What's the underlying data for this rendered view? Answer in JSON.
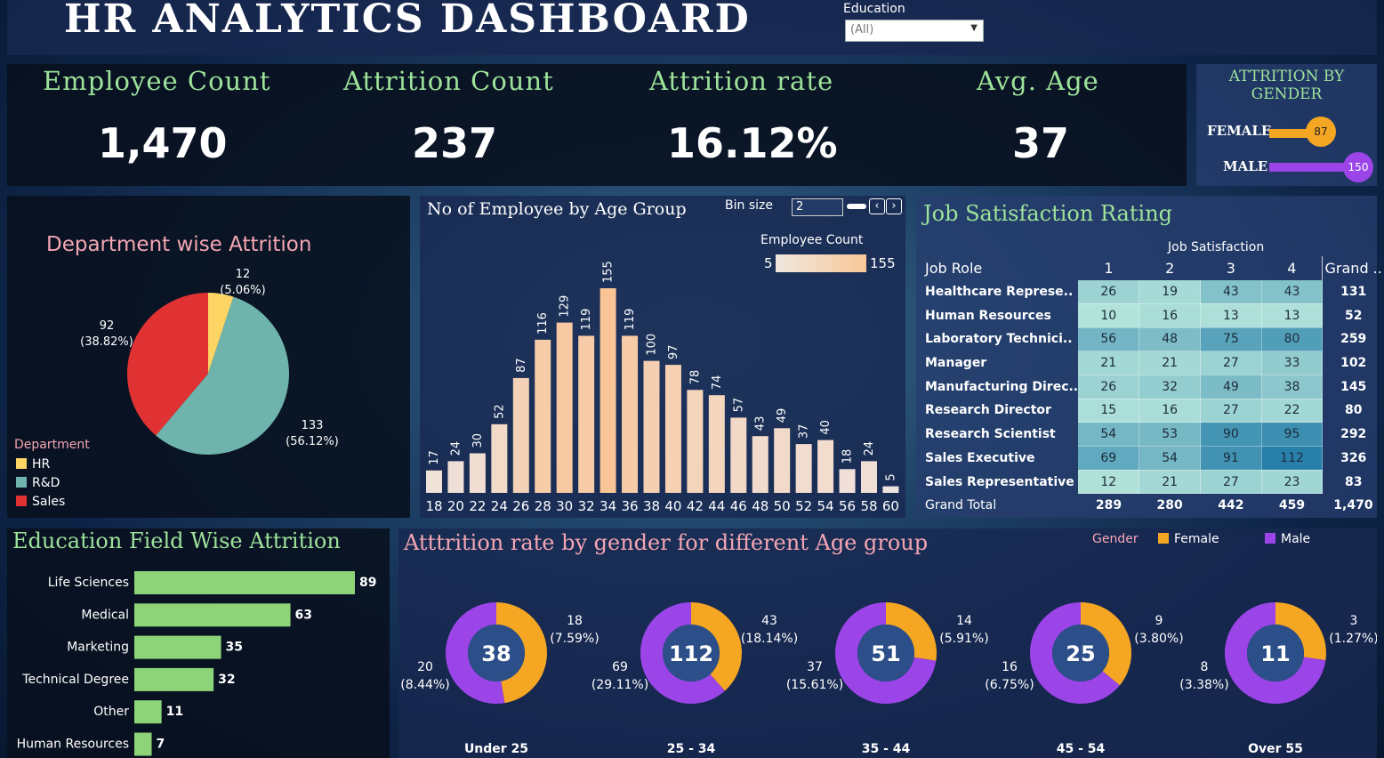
{
  "title": "HR ANALYTICS DASHBOARD",
  "filter": {
    "label": "Education",
    "value": "(All)"
  },
  "kpis": [
    {
      "title": "Employee Count",
      "value": "1,470"
    },
    {
      "title": "Attrition Count",
      "value": "237"
    },
    {
      "title": "Attrition rate",
      "value": "16.12%"
    },
    {
      "title": "Avg. Age",
      "value": "37"
    }
  ],
  "gender_attrition": {
    "title_l1": "ATTRITION BY",
    "title_l2": "GENDER",
    "items": [
      {
        "label": "FEMALE",
        "value": 87,
        "color": "#f5a623"
      },
      {
        "label": "MALE",
        "value": 150,
        "color": "#9b45e8"
      }
    ]
  },
  "dept": {
    "title": "Department wise Attrition",
    "legend_title": "Department",
    "slices": [
      {
        "name": "HR",
        "value": 12,
        "label": "12",
        "pct": "(5.06%)",
        "color": "#fcd565"
      },
      {
        "name": "R&D",
        "value": 133,
        "label": "133",
        "pct": "(56.12%)",
        "color": "#6fb3ad"
      },
      {
        "name": "Sales",
        "value": 92,
        "label": "92",
        "pct": "(38.82%)",
        "color": "#e03232"
      }
    ]
  },
  "age": {
    "title": "No of Employee by Age Group",
    "bin_label": "Bin size",
    "bin_value": "2",
    "legend_title": "Employee Count",
    "legend_min": "5",
    "legend_max": "155",
    "categories": [
      "18",
      "20",
      "22",
      "24",
      "26",
      "28",
      "30",
      "32",
      "34",
      "36",
      "38",
      "40",
      "42",
      "44",
      "46",
      "48",
      "50",
      "52",
      "54",
      "56",
      "58",
      "60"
    ],
    "values": [
      17,
      24,
      30,
      52,
      87,
      116,
      129,
      119,
      155,
      119,
      100,
      97,
      78,
      74,
      57,
      43,
      49,
      37,
      40,
      18,
      24,
      5
    ]
  },
  "job": {
    "title": "Job Satisfaction Rating",
    "col_group": "Job Satisfaction",
    "role_header": "Job Role",
    "cols": [
      "1",
      "2",
      "3",
      "4"
    ],
    "grand_header": "Grand ..",
    "rows": [
      {
        "role": "Healthcare Represe..",
        "v": [
          26,
          19,
          43,
          43
        ],
        "total": "131"
      },
      {
        "role": "Human Resources",
        "v": [
          10,
          16,
          13,
          13
        ],
        "total": "52"
      },
      {
        "role": "Laboratory Technici..",
        "v": [
          56,
          48,
          75,
          80
        ],
        "total": "259"
      },
      {
        "role": "Manager",
        "v": [
          21,
          21,
          27,
          33
        ],
        "total": "102"
      },
      {
        "role": "Manufacturing Direc..",
        "v": [
          26,
          32,
          49,
          38
        ],
        "total": "145"
      },
      {
        "role": "Research Director",
        "v": [
          15,
          16,
          27,
          22
        ],
        "total": "80"
      },
      {
        "role": "Research Scientist",
        "v": [
          54,
          53,
          90,
          95
        ],
        "total": "292"
      },
      {
        "role": "Sales Executive",
        "v": [
          69,
          54,
          91,
          112
        ],
        "total": "326"
      },
      {
        "role": "Sales Representative",
        "v": [
          12,
          21,
          27,
          23
        ],
        "total": "83"
      }
    ],
    "grand_label": "Grand Total",
    "grand": [
      "289",
      "280",
      "442",
      "459",
      "1,470"
    ]
  },
  "edu": {
    "title": "Education Field Wise Attrition",
    "items": [
      {
        "label": "Life Sciences",
        "value": 89
      },
      {
        "label": "Medical",
        "value": 63
      },
      {
        "label": "Marketing",
        "value": 35
      },
      {
        "label": "Technical Degree",
        "value": 32
      },
      {
        "label": "Other",
        "value": 11
      },
      {
        "label": "Human Resources",
        "value": 7
      }
    ],
    "color": "#8dd378"
  },
  "donuts": {
    "title": "Atttrition rate by gender for different Age group",
    "legend_title": "Gender",
    "female_label": "Female",
    "male_label": "Male",
    "female_color": "#f5a623",
    "male_color": "#9b45e8",
    "groups": [
      {
        "name": "Under 25",
        "total": "38",
        "female": 18,
        "female_pct": "(7.59%)",
        "male": 20,
        "male_pct": "(8.44%)"
      },
      {
        "name": "25 - 34",
        "total": "112",
        "female": 43,
        "female_pct": "(18.14%)",
        "male": 69,
        "male_pct": "(29.11%)"
      },
      {
        "name": "35 - 44",
        "total": "51",
        "female": 14,
        "female_pct": "(5.91%)",
        "male": 37,
        "male_pct": "(15.61%)"
      },
      {
        "name": "45 - 54",
        "total": "25",
        "female": 9,
        "female_pct": "(3.80%)",
        "male": 16,
        "male_pct": "(6.75%)"
      },
      {
        "name": "Over 55",
        "total": "11",
        "female": 3,
        "female_pct": "(1.27%)",
        "male": 8,
        "male_pct": "(3.38%)"
      }
    ]
  }
}
